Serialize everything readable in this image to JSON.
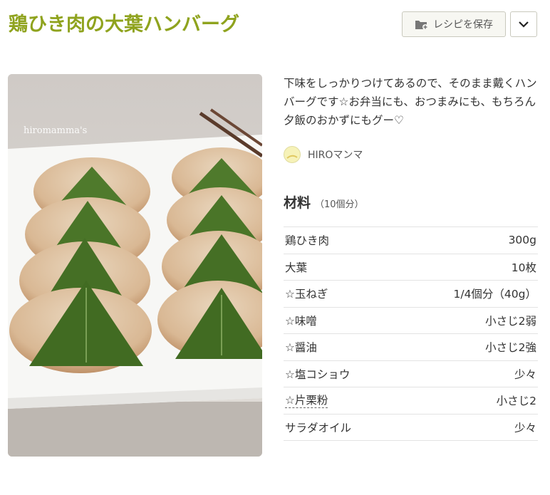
{
  "recipe": {
    "title": "鶏ひき肉の大葉ハンバーグ",
    "save_label": "レシピを保存",
    "photo_watermark": "hiromamma's",
    "description": "下味をしっかりつけてあるので、そのまま戴くハンバーグです☆お弁当にも、おつまみにも、もちろん夕飯のおかずにもグー♡",
    "author": "HIROマンマ"
  },
  "ingredients": {
    "heading": "材料",
    "servings": "（10個分）",
    "items": [
      {
        "name": "鶏ひき肉",
        "amount": "300g"
      },
      {
        "name": "大葉",
        "amount": "10枚"
      },
      {
        "name": "☆玉ねぎ",
        "amount": "1/4個分（40g）"
      },
      {
        "name": "☆味噌",
        "amount": "小さじ2弱"
      },
      {
        "name": "☆醤油",
        "amount": "小さじ2強"
      },
      {
        "name": "☆塩コショウ",
        "amount": "少々"
      },
      {
        "name": "☆片栗粉",
        "amount": "小さじ2"
      },
      {
        "name": "サラダオイル",
        "amount": "少々"
      }
    ]
  },
  "icons": {
    "save": "folder-plus-icon",
    "menu": "chevron-down-icon"
  },
  "colors": {
    "title": "#8fa31e",
    "button_bg": "#f7f7f2",
    "divider": "#e3e3e3"
  }
}
